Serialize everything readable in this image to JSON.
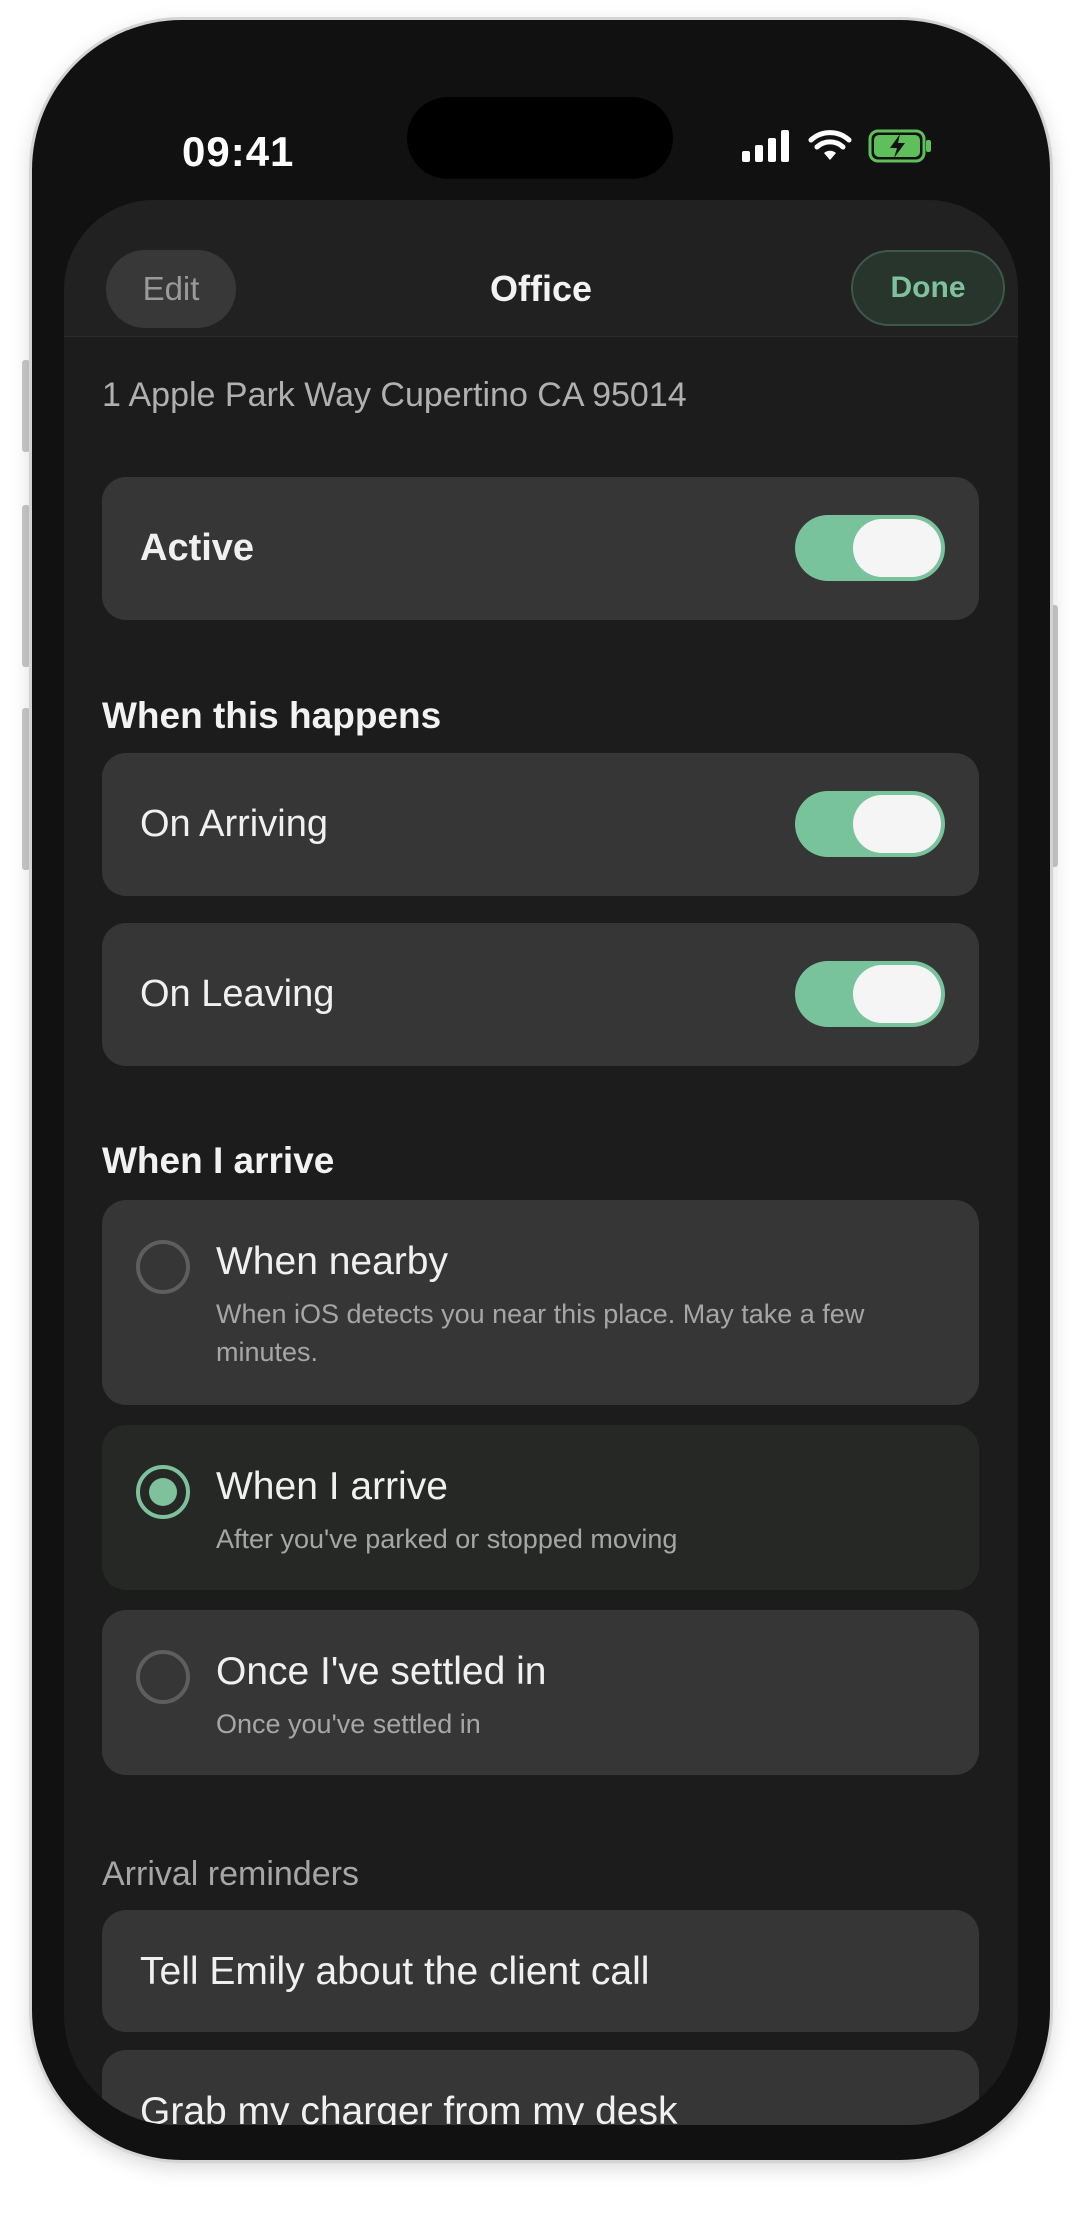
{
  "status_bar": {
    "time": "09:41"
  },
  "nav": {
    "edit_label": "Edit",
    "title": "Office",
    "done_label": "Done"
  },
  "address": "1 Apple Park Way Cupertino CA 95014",
  "active": {
    "label": "Active",
    "on": true
  },
  "triggers": {
    "title": "When this happens",
    "items": [
      {
        "label": "On Arriving",
        "on": true
      },
      {
        "label": "On Leaving",
        "on": true
      }
    ]
  },
  "arrive": {
    "title": "When I arrive",
    "options": [
      {
        "title": "When nearby",
        "desc": "When iOS detects you near this place. May take a few minutes.",
        "selected": false
      },
      {
        "title": "When I arrive",
        "desc": "After you've parked or stopped moving",
        "selected": true
      },
      {
        "title": "Once I've settled in",
        "desc": "Once you've settled in",
        "selected": false
      }
    ]
  },
  "reminders": {
    "title": "Arrival reminders",
    "items": [
      "Tell Emily about the client call",
      "Grab my charger from my desk"
    ]
  },
  "colors": {
    "accent": "#7fc19c",
    "toggle_on": "#78c39b",
    "background": "#1c1c1c",
    "card": "#363636"
  }
}
